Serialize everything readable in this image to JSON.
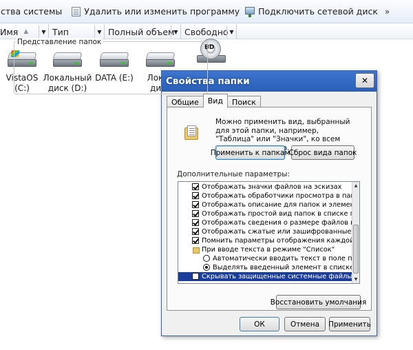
{
  "toolbar": {
    "system_properties": "ства системы",
    "uninstall": "Удалить или изменить программу",
    "map_drive": "Подключить сетевой диск",
    "more": "»"
  },
  "columns": [
    "Имя",
    "Тип",
    "Полный объем",
    "Свободно"
  ],
  "drives": [
    {
      "name": "VistaOS",
      "letter": "(C:)"
    },
    {
      "name": "Локальный",
      "letter": "диск (D:)"
    },
    {
      "name": "DATA (E:)",
      "letter": ""
    },
    {
      "name": "Локал",
      "letter": "диск"
    },
    {
      "name": "BD",
      "letter": ""
    }
  ],
  "dialog": {
    "title": "Свойства папки",
    "close": "✕",
    "tabs": [
      "Общие",
      "Вид",
      "Поиск"
    ],
    "active_tab": "Вид",
    "folder_views": {
      "group_title": "Представление папок",
      "description": "Можно применить вид, выбранный для этой папки, например, \"Таблица\" или \"Значки\", ко всем папкам этого типа.",
      "apply_button": "Применить к папкам",
      "reset_button": "Сброс вида папок"
    },
    "advanced": {
      "label": "Дополнительные параметры:",
      "items": [
        {
          "type": "checkbox",
          "checked": true,
          "label": "Отображать значки файлов на эскизах"
        },
        {
          "type": "checkbox",
          "checked": true,
          "label": "Отображать обработчики просмотра в панели пр"
        },
        {
          "type": "checkbox",
          "checked": true,
          "label": "Отображать описание для папок и элементов раб"
        },
        {
          "type": "checkbox",
          "checked": true,
          "label": "Отображать простой вид папок в списке папок \"П"
        },
        {
          "type": "checkbox",
          "checked": true,
          "label": "Отображать сведения о размере файлов в подска"
        },
        {
          "type": "checkbox",
          "checked": true,
          "label": "Отображать сжатые или зашифрованные файлы N"
        },
        {
          "type": "checkbox",
          "checked": true,
          "label": "Помнить параметры отображения каждой папки"
        },
        {
          "type": "folder",
          "checked": false,
          "label": "При вводе текста в режиме \"Список\""
        },
        {
          "type": "radio",
          "checked": false,
          "label": "Автоматически вводить текст в поле поиска"
        },
        {
          "type": "radio",
          "checked": true,
          "label": "Выделять введенный элемент в списке"
        },
        {
          "type": "checkbox",
          "checked": false,
          "label": "Скрывать защищенные системные файлы (рекоме",
          "selected": true
        }
      ],
      "restore_button": "Восстановить умолчания"
    },
    "ok_button": "ОК",
    "cancel_button": "Отмена",
    "apply_button": "Применить"
  }
}
